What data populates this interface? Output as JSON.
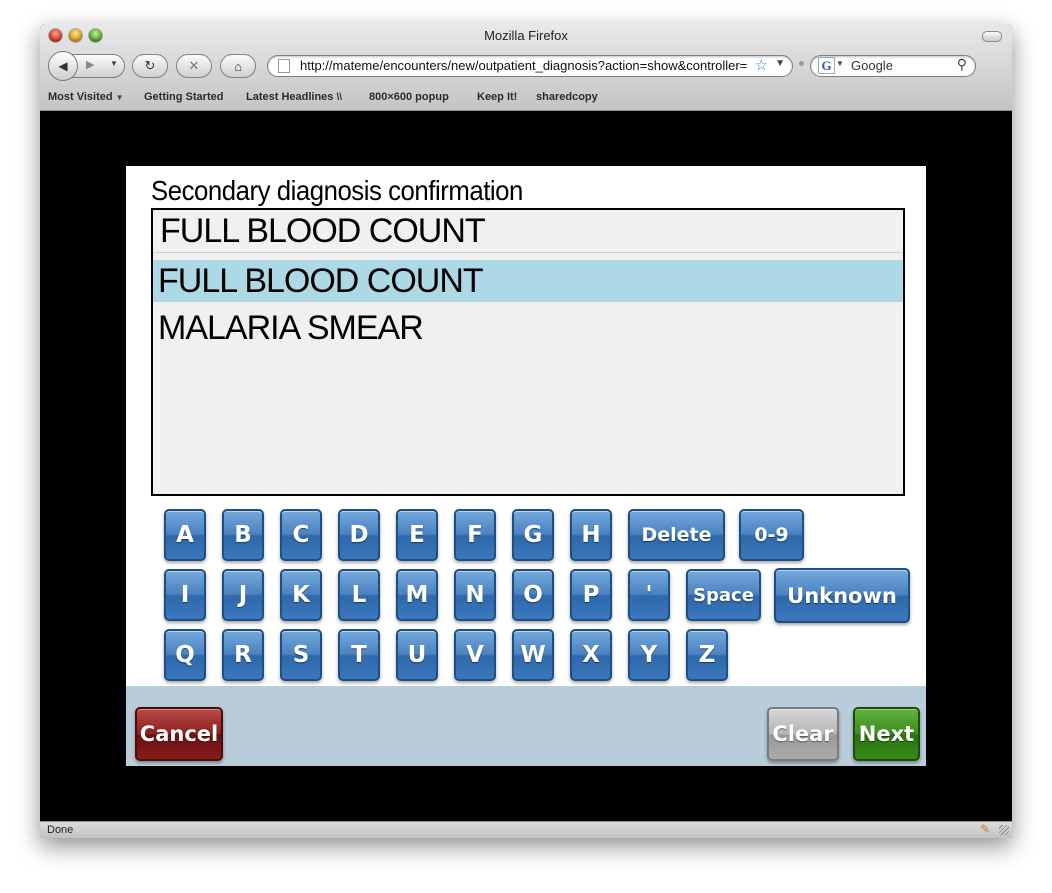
{
  "window": {
    "title": "Mozilla Firefox"
  },
  "toolbar": {
    "url": "http://mateme/encounters/new/outpatient_diagnosis?action=show&controller=",
    "search_placeholder": "Google",
    "search_engine_glyph": "G"
  },
  "bookmarks": [
    {
      "label": "Most Visited",
      "has_dropdown": true
    },
    {
      "label": "Getting Started"
    },
    {
      "label": "Latest Headlines",
      "icon": "rss-icon"
    },
    {
      "label": "800×600 popup"
    },
    {
      "label": "Keep It!"
    },
    {
      "label": "sharedcopy"
    }
  ],
  "page": {
    "helptext": "Secondary diagnosis confirmation",
    "input_value": "FULL BLOOD COUNT",
    "options": [
      {
        "label": "FULL BLOOD COUNT",
        "selected": true
      },
      {
        "label": "MALARIA SMEAR",
        "selected": false
      }
    ],
    "keyboard": {
      "row1": [
        "A",
        "B",
        "C",
        "D",
        "E",
        "F",
        "G",
        "H"
      ],
      "row1_extra": [
        "Delete",
        "0-9"
      ],
      "row2": [
        "I",
        "J",
        "K",
        "L",
        "M",
        "N",
        "O",
        "P",
        "'"
      ],
      "row2_extra": [
        "Space",
        "Unknown"
      ],
      "row3": [
        "Q",
        "R",
        "S",
        "T",
        "U",
        "V",
        "W",
        "X",
        "Y",
        "Z"
      ]
    },
    "buttons": {
      "cancel": "Cancel",
      "clear": "Clear",
      "next": "Next"
    }
  },
  "status": {
    "text": "Done"
  },
  "colors": {
    "selected_option": "#add8e6",
    "key_blue": "#3a78bd",
    "cancel_red": "#8e1f1f",
    "next_green": "#3d8b1e",
    "footer_bg": "#b9ccd9"
  }
}
